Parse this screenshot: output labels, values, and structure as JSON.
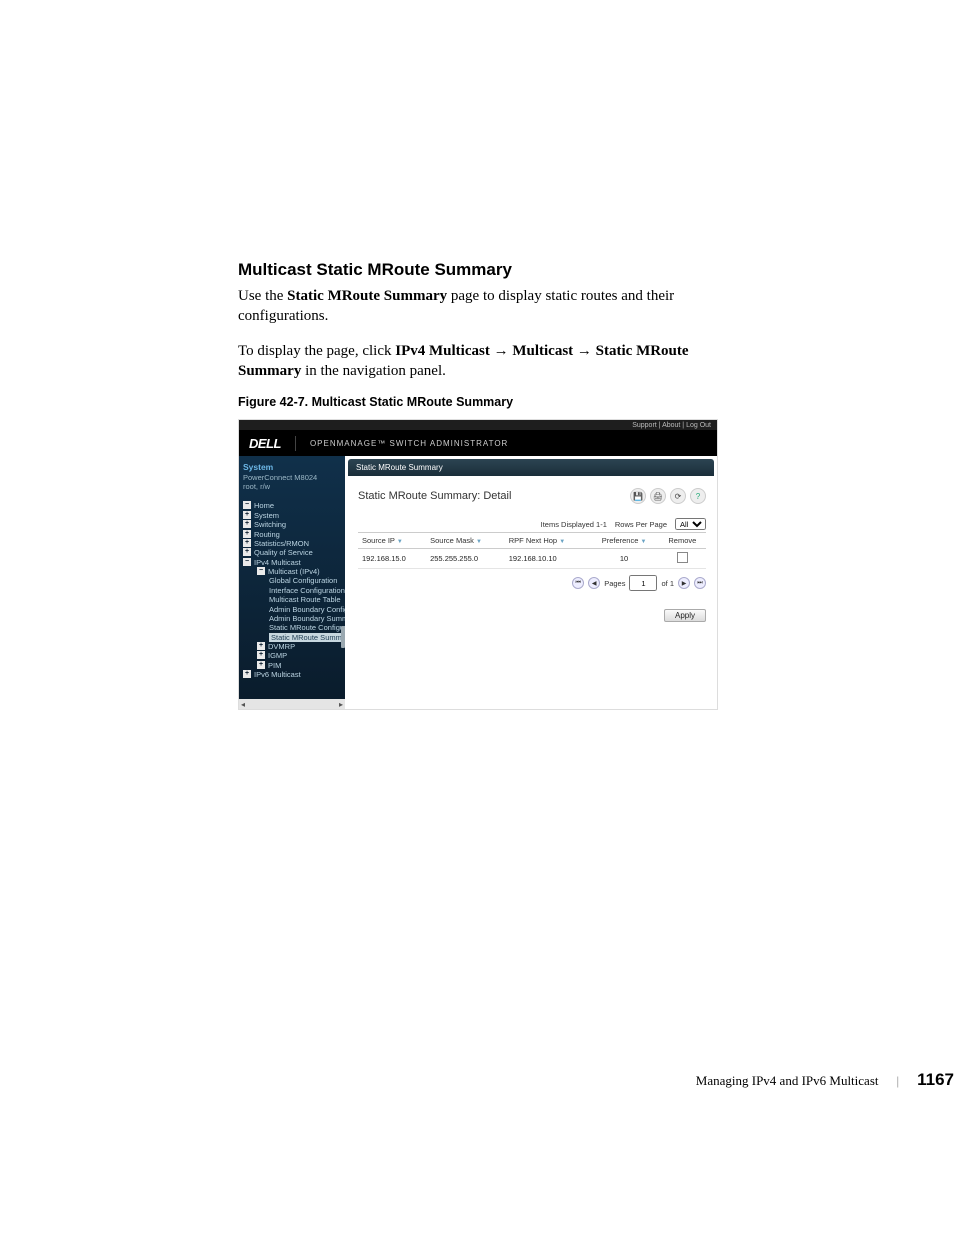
{
  "section": {
    "title": "Multicast Static MRoute Summary"
  },
  "body": {
    "p1_a": "Use the ",
    "p1_b": "Static MRoute Summary",
    "p1_c": " page to display static routes and their configurations.",
    "p2_a": "To display the page, click ",
    "p2_b": "IPv4 Multicast",
    "p2_c": " → ",
    "p2_d": "Multicast",
    "p2_e": " → ",
    "p2_f": "Static MRoute Summary",
    "p2_g": " in the navigation panel."
  },
  "figure": {
    "caption": "Figure 42-7.    Multicast Static MRoute Summary"
  },
  "app": {
    "top_links": [
      "Support",
      "About",
      "Log Out"
    ],
    "logo": "DELL",
    "product": "OPENMANAGE™  SWITCH  ADMINISTRATOR",
    "sidebar": {
      "sys_title": "System",
      "sys_model": "PowerConnect M8024",
      "sys_user": "root, r/w",
      "items": [
        {
          "icon": "minus",
          "level": 0,
          "label": "Home"
        },
        {
          "icon": "plus",
          "level": 0,
          "label": "System"
        },
        {
          "icon": "plus",
          "level": 0,
          "label": "Switching"
        },
        {
          "icon": "plus",
          "level": 0,
          "label": "Routing"
        },
        {
          "icon": "plus",
          "level": 0,
          "label": "Statistics/RMON"
        },
        {
          "icon": "plus",
          "level": 0,
          "label": "Quality of Service"
        },
        {
          "icon": "minus",
          "level": 0,
          "label": "IPv4 Multicast"
        },
        {
          "icon": "minus",
          "level": 1,
          "label": "Multicast (IPv4)"
        },
        {
          "icon": "",
          "level": 2,
          "label": "Global Configuration"
        },
        {
          "icon": "",
          "level": 2,
          "label": "Interface Configuration"
        },
        {
          "icon": "",
          "level": 2,
          "label": "Multicast Route Table"
        },
        {
          "icon": "",
          "level": 2,
          "label": "Admin Boundary Configuration"
        },
        {
          "icon": "",
          "level": 2,
          "label": "Admin Boundary Summary"
        },
        {
          "icon": "",
          "level": 2,
          "label": "Static MRoute Configuration"
        },
        {
          "icon": "",
          "level": 2,
          "label": "Static MRoute Summary",
          "selected": true
        },
        {
          "icon": "plus",
          "level": 1,
          "label": "DVMRP"
        },
        {
          "icon": "plus",
          "level": 1,
          "label": "IGMP"
        },
        {
          "icon": "plus",
          "level": 1,
          "label": "PIM"
        },
        {
          "icon": "plus",
          "level": 0,
          "label": "IPv6 Multicast"
        }
      ]
    },
    "breadcrumb": "Static MRoute Summary",
    "panel_title": "Static MRoute Summary: Detail",
    "meta": {
      "items_displayed": "Items Displayed 1-1",
      "rows_label": "Rows Per Page",
      "rows_value": "All"
    },
    "columns": [
      "Source IP",
      "Source Mask",
      "RPF Next Hop",
      "Preference",
      "Remove"
    ],
    "rows": [
      {
        "source_ip": "192.168.15.0",
        "source_mask": "255.255.255.0",
        "rpf_next_hop": "192.168.10.10",
        "preference": "10",
        "remove": false
      }
    ],
    "pager": {
      "pages_label": "Pages",
      "current": "1",
      "of_label": "of 1"
    },
    "buttons": {
      "apply": "Apply"
    }
  },
  "footer": {
    "chapter": "Managing IPv4 and IPv6 Multicast",
    "page": "1167"
  }
}
